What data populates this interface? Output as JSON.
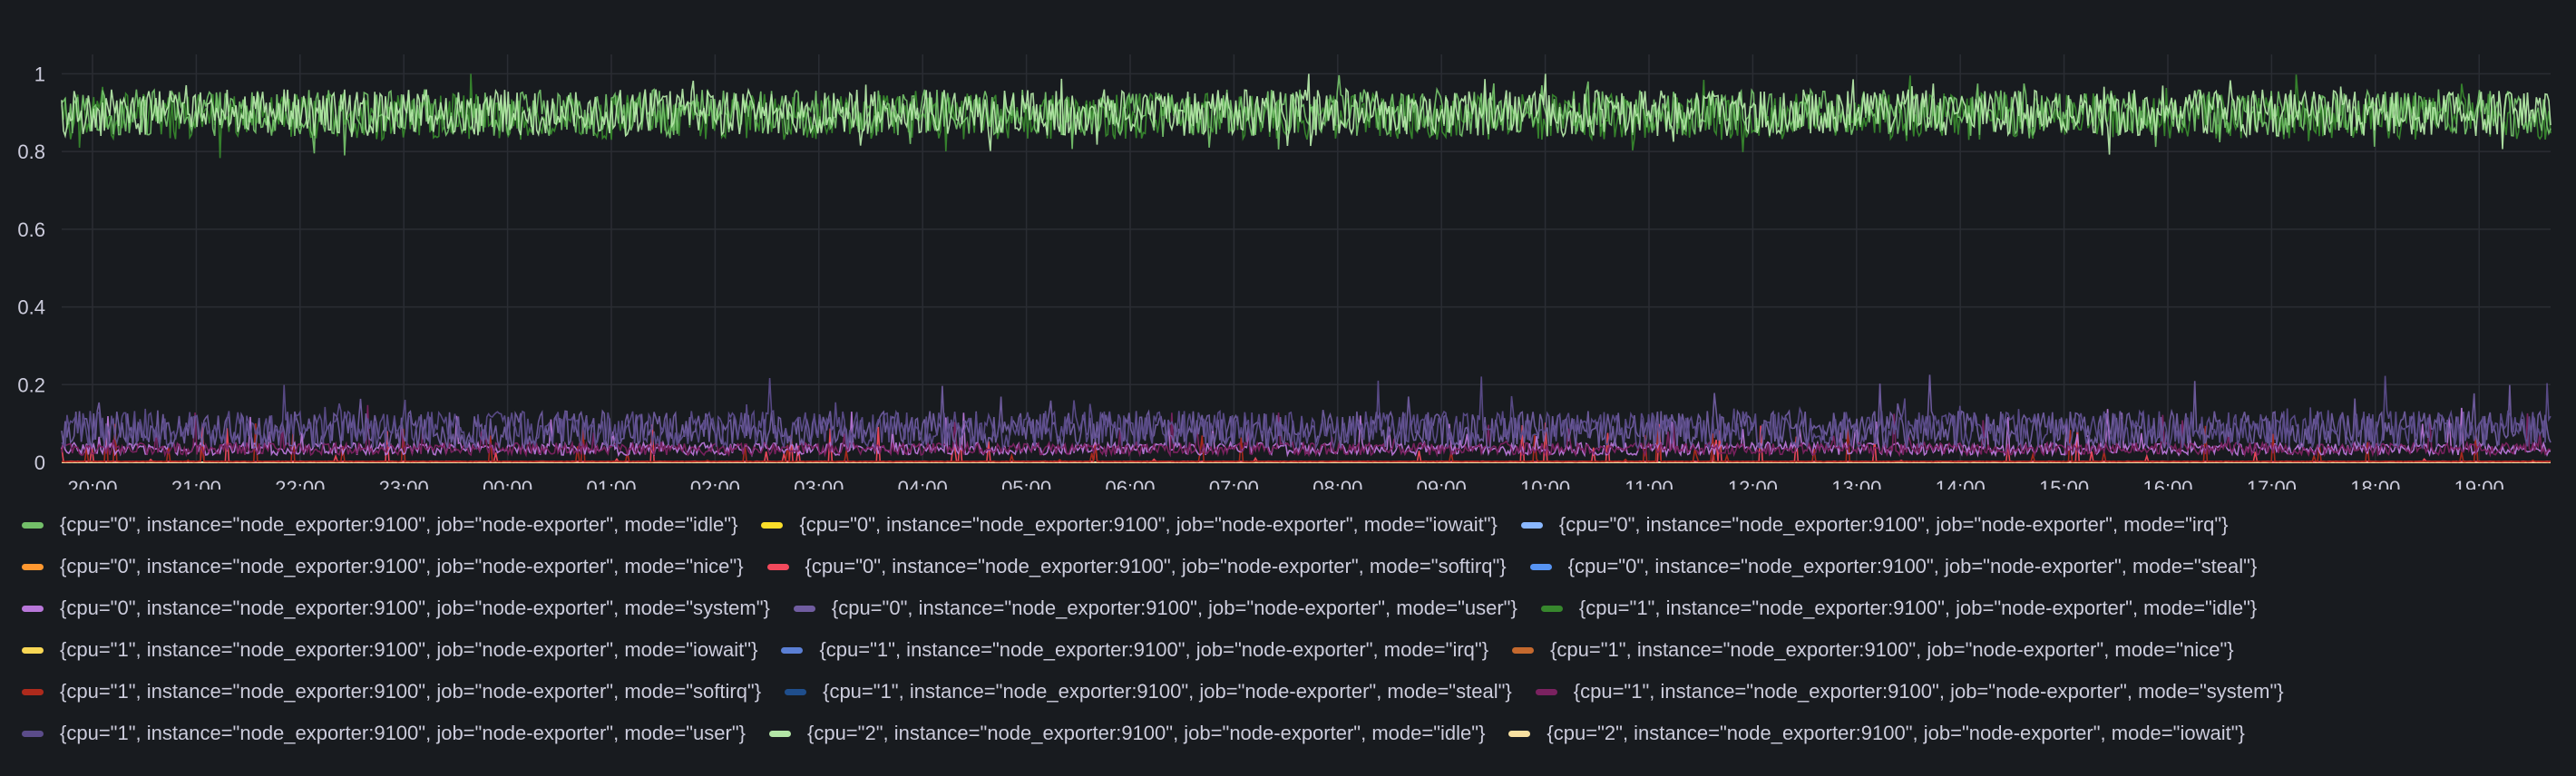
{
  "chart_data": {
    "type": "line",
    "ylim": [
      0,
      1.05
    ],
    "y_ticks": [
      "0",
      "0.2",
      "0.4",
      "0.6",
      "0.8",
      "1"
    ],
    "x_ticks": [
      "20:00",
      "21:00",
      "22:00",
      "23:00",
      "00:00",
      "01:00",
      "02:00",
      "03:00",
      "04:00",
      "05:00",
      "06:00",
      "07:00",
      "08:00",
      "09:00",
      "10:00",
      "11:00",
      "12:00",
      "13:00",
      "14:00",
      "15:00",
      "16:00",
      "17:00",
      "18:00",
      "19:00"
    ],
    "grid": true,
    "legend_position": "bottom",
    "series": [
      {
        "name": "{cpu=\"0\", instance=\"node_exporter:9100\", job=\"node-exporter\", mode=\"idle\"}",
        "color": "#73bf69",
        "mean": 0.9,
        "spread": 0.06
      },
      {
        "name": "{cpu=\"0\", instance=\"node_exporter:9100\", job=\"node-exporter\", mode=\"iowait\"}",
        "color": "#fade2a",
        "mean": 0.0,
        "spread": 0.0
      },
      {
        "name": "{cpu=\"0\", instance=\"node_exporter:9100\", job=\"node-exporter\", mode=\"irq\"}",
        "color": "#8ab8ff",
        "mean": 0.0,
        "spread": 0.0
      },
      {
        "name": "{cpu=\"0\", instance=\"node_exporter:9100\", job=\"node-exporter\", mode=\"nice\"}",
        "color": "#ff9830",
        "mean": 0.0,
        "spread": 0.0
      },
      {
        "name": "{cpu=\"0\", instance=\"node_exporter:9100\", job=\"node-exporter\", mode=\"softirq\"}",
        "color": "#f2495c",
        "mean": 0.002,
        "spread": 0.001
      },
      {
        "name": "{cpu=\"0\", instance=\"node_exporter:9100\", job=\"node-exporter\", mode=\"steal\"}",
        "color": "#5794f2",
        "mean": 0.0,
        "spread": 0.0
      },
      {
        "name": "{cpu=\"0\", instance=\"node_exporter:9100\", job=\"node-exporter\", mode=\"system\"}",
        "color": "#b877d9",
        "mean": 0.03,
        "spread": 0.02
      },
      {
        "name": "{cpu=\"0\", instance=\"node_exporter:9100\", job=\"node-exporter\", mode=\"user\"}",
        "color": "#705da0",
        "mean": 0.07,
        "spread": 0.06
      },
      {
        "name": "{cpu=\"1\", instance=\"node_exporter:9100\", job=\"node-exporter\", mode=\"idle\"}",
        "color": "#37872d",
        "mean": 0.89,
        "spread": 0.06
      },
      {
        "name": "{cpu=\"1\", instance=\"node_exporter:9100\", job=\"node-exporter\", mode=\"iowait\"}",
        "color": "#f8d755",
        "mean": 0.0,
        "spread": 0.0
      },
      {
        "name": "{cpu=\"1\", instance=\"node_exporter:9100\", job=\"node-exporter\", mode=\"irq\"}",
        "color": "#5b7fd4",
        "mean": 0.0,
        "spread": 0.0
      },
      {
        "name": "{cpu=\"1\", instance=\"node_exporter:9100\", job=\"node-exporter\", mode=\"nice\"}",
        "color": "#c4692e",
        "mean": 0.0,
        "spread": 0.0
      },
      {
        "name": "{cpu=\"1\", instance=\"node_exporter:9100\", job=\"node-exporter\", mode=\"softirq\"}",
        "color": "#ad2a1c",
        "mean": 0.002,
        "spread": 0.001
      },
      {
        "name": "{cpu=\"1\", instance=\"node_exporter:9100\", job=\"node-exporter\", mode=\"steal\"}",
        "color": "#1f4e8c",
        "mean": 0.0,
        "spread": 0.0
      },
      {
        "name": "{cpu=\"1\", instance=\"node_exporter:9100\", job=\"node-exporter\", mode=\"system\"}",
        "color": "#7a2260",
        "mean": 0.03,
        "spread": 0.02
      },
      {
        "name": "{cpu=\"1\", instance=\"node_exporter:9100\", job=\"node-exporter\", mode=\"user\"}",
        "color": "#5b4c8a",
        "mean": 0.07,
        "spread": 0.06
      },
      {
        "name": "{cpu=\"2\", instance=\"node_exporter:9100\", job=\"node-exporter\", mode=\"idle\"}",
        "color": "#b3e6a6",
        "mean": 0.9,
        "spread": 0.06
      },
      {
        "name": "{cpu=\"2\", instance=\"node_exporter:9100\", job=\"node-exporter\", mode=\"iowait\"}",
        "color": "#f7e0a0",
        "mean": 0.0,
        "spread": 0.0
      }
    ]
  }
}
